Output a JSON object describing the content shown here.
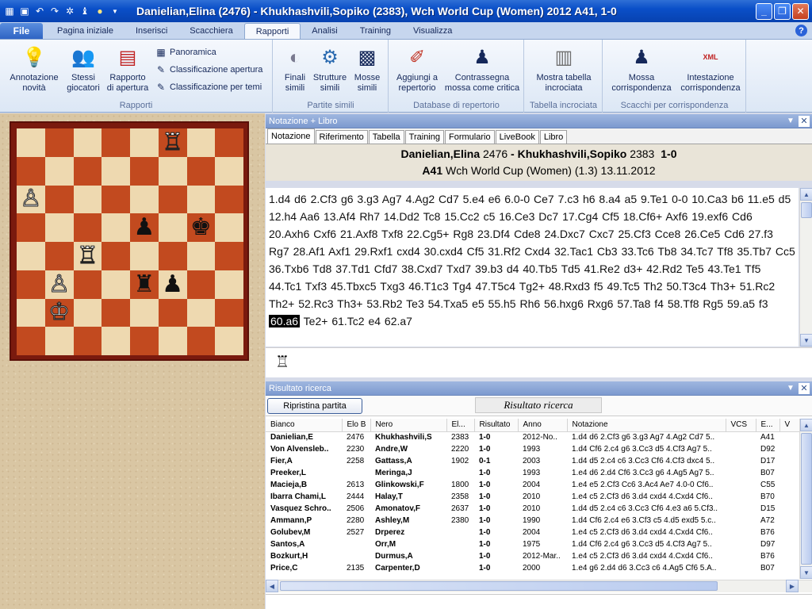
{
  "window": {
    "title": "Danielian,Elina (2476) - Khukhashvili,Sopiko (2383), Wch World Cup (Women) 2012  A41, 1-0",
    "qat_icons": [
      "board-icon",
      "save-icon",
      "undo-icon",
      "redo-icon",
      "engine-icon",
      "piece-icon",
      "bulb-icon",
      "dropdown-icon"
    ],
    "minimize": "_",
    "maximize": "❐",
    "close": "✕"
  },
  "ribbon": {
    "file_tab": "File",
    "tabs": [
      "Pagina iniziale",
      "Inserisci",
      "Scacchiera",
      "Rapporti",
      "Analisi",
      "Training",
      "Visualizza"
    ],
    "active_tab": "Rapporti",
    "help": "?",
    "groups": {
      "rapporti": {
        "label": "Rapporti",
        "annotazione": "Annotazione novità",
        "annotazione_l1": "Annotazione",
        "annotazione_l2": "novità",
        "stessi_l1": "Stessi",
        "stessi_l2": "giocatori",
        "rapporto_l1": "Rapporto",
        "rapporto_l2": "di apertura",
        "panoramica": "Panoramica",
        "class_apertura": "Classificazione apertura",
        "class_temi": "Classificazione per temi"
      },
      "partite_simili": {
        "label": "Partite simili",
        "finali_l1": "Finali",
        "finali_l2": "simili",
        "strutture_l1": "Strutture",
        "strutture_l2": "simili",
        "mosse_l1": "Mosse",
        "mosse_l2": "simili"
      },
      "database": {
        "label": "Database di repertorio",
        "aggiungi_l1": "Aggiungi a",
        "aggiungi_l2": "repertorio",
        "contrassegna_l1": "Contrassegna",
        "contrassegna_l2": "mossa come critica"
      },
      "tabella": {
        "label": "Tabella incrociata",
        "mostra_l1": "Mostra tabella",
        "mostra_l2": "incrociata"
      },
      "corrispondenza": {
        "label": "Scacchi per corrispondenza",
        "mossa_l1": "Mossa",
        "mossa_l2": "corrispondenza",
        "intest_l1": "Intestazione",
        "intest_l2": "corrispondenza",
        "xml_badge": "XML"
      }
    }
  },
  "board": {
    "squares": [
      "",
      "",
      "",
      "",
      "",
      "R",
      "",
      "",
      "",
      "",
      "",
      "",
      "",
      "",
      "",
      "",
      "P",
      "",
      "",
      "",
      "",
      "",
      "",
      "",
      "",
      "",
      "",
      "",
      "p",
      "",
      "k",
      "",
      "",
      "",
      "R",
      "",
      "",
      "",
      "",
      "",
      "",
      "P",
      "",
      "",
      "r",
      "p",
      "",
      "",
      "",
      "K",
      "",
      "",
      "",
      "",
      "",
      "",
      "",
      "",
      "",
      "",
      "",
      "",
      "",
      ""
    ]
  },
  "notation_pane": {
    "title": "Notazione + Libro",
    "tabs": [
      "Notazione",
      "Riferimento",
      "Tabella",
      "Training",
      "Formulario",
      "LiveBook",
      "Libro"
    ],
    "active_tab": "Notazione",
    "white": "Danielian,Elina",
    "white_elo": "2476",
    "sep": "-",
    "black": "Khukhashvili,Sopiko",
    "black_elo": "2383",
    "result": "1-0",
    "eco": "A41",
    "event": "Wch World Cup (Women) (1.3) 13.11.2012",
    "moves_before": "1.d4  d6  2.Cf3  g6  3.g3  Ag7  4.Ag2  Cd7  5.e4  e6  6.0-0  Ce7  7.c3  h6  8.a4  a5  9.Te1  0-0  10.Ca3  b6  11.e5  d5  12.h4  Aa6  13.Af4  Rh7  14.Dd2  Tc8  15.Cc2  c5  16.Ce3  Dc7  17.Cg4  Cf5  18.Cf6+  Axf6  19.exf6  Cd6  20.Axh6  Cxf6  21.Axf8  Txf8  22.Cg5+  Rg8  23.Df4  Cde8  24.Dxc7  Cxc7  25.Cf3  Cce8  26.Ce5  Cd6  27.f3  Rg7  28.Af1  Axf1  29.Rxf1  cxd4  30.cxd4  Cf5  31.Rf2  Cxd4  32.Tac1  Cb3  33.Tc6  Tb8  34.Tc7  Tf8  35.Tb7  Cc5  36.Txb6  Td8  37.Td1  Cfd7  38.Cxd7  Txd7  39.b3  d4  40.Tb5  Td5  41.Re2  d3+  42.Rd2  Te5  43.Te1  Tf5  44.Tc1  Txf3  45.Tbxc5  Txg3  46.T1c3  Tg4  47.T5c4  Tg2+  48.Rxd3  f5  49.Tc5  Th2  50.T3c4  Th3+  51.Rc2  Th2+  52.Rc3  Th3+  53.Rb2  Te3  54.Txa5  e5  55.h5  Rh6  56.hxg6  Rxg6  57.Ta8  f4  58.Tf8  Rg5  59.a5  f3  ",
    "current_move": "60.a6",
    "moves_after": "  Te2+  61.Tc2  e4  62.a7"
  },
  "search_pane": {
    "title": "Risultato ricerca",
    "reset_button": "Ripristina partita",
    "label": "Risultato ricerca",
    "columns": [
      "Bianco",
      "Elo B",
      "Nero",
      "El...",
      "Risultato",
      "Anno",
      "Notazione",
      "VCS",
      "E...",
      "V"
    ],
    "rows": [
      [
        "Danielian,E",
        "2476",
        "Khukhashvili,S",
        "2383",
        "1-0",
        "2012-No..",
        "1.d4 d6 2.Cf3 g6 3.g3 Ag7 4.Ag2 Cd7 5..",
        "",
        "A41"
      ],
      [
        "Von Alvensleb..",
        "2230",
        "Andre,W",
        "2220",
        "1-0",
        "1993",
        "1.d4 Cf6 2.c4 g6 3.Cc3 d5 4.Cf3 Ag7 5..",
        "",
        "D92"
      ],
      [
        "Fier,A",
        "2258",
        "Gattass,A",
        "1902",
        "0-1",
        "2003",
        "1.d4 d5 2.c4 c6 3.Cc3 Cf6 4.Cf3 dxc4 5..",
        "",
        "D17"
      ],
      [
        "Preeker,L",
        "",
        "Meringa,J",
        "",
        "1-0",
        "1993",
        "1.e4 d6 2.d4 Cf6 3.Cc3 g6 4.Ag5 Ag7 5..",
        "",
        "B07"
      ],
      [
        "Macieja,B",
        "2613",
        "Glinkowski,F",
        "1800",
        "1-0",
        "2004",
        "1.e4 e5 2.Cf3 Cc6 3.Ac4 Ae7 4.0-0 Cf6..",
        "",
        "C55"
      ],
      [
        "Ibarra Chami,L",
        "2444",
        "Halay,T",
        "2358",
        "1-0",
        "2010",
        "1.e4 c5 2.Cf3 d6 3.d4 cxd4 4.Cxd4 Cf6..",
        "",
        "B70"
      ],
      [
        "Vasquez Schro..",
        "2506",
        "Amonatov,F",
        "2637",
        "1-0",
        "2010",
        "1.d4 d5 2.c4 c6 3.Cc3 Cf6 4.e3 a6 5.Cf3..",
        "",
        "D15"
      ],
      [
        "Ammann,P",
        "2280",
        "Ashley,M",
        "2380",
        "1-0",
        "1990",
        "1.d4 Cf6 2.c4 e6 3.Cf3 c5 4.d5 exd5 5.c..",
        "",
        "A72"
      ],
      [
        "Golubev,M",
        "2527",
        "Drperez",
        "",
        "1-0",
        "2004",
        "1.e4 c5 2.Cf3 d6 3.d4 cxd4 4.Cxd4 Cf6..",
        "",
        "B76"
      ],
      [
        "Santos,A",
        "",
        "Orr,M",
        "",
        "1-0",
        "1975",
        "1.d4 Cf6 2.c4 g6 3.Cc3 d5 4.Cf3 Ag7 5..",
        "",
        "D97"
      ],
      [
        "Bozkurt,H",
        "",
        "Durmus,A",
        "",
        "1-0",
        "2012-Mar..",
        "1.e4 c5 2.Cf3 d6 3.d4 cxd4 4.Cxd4 Cf6..",
        "",
        "B76"
      ],
      [
        "Price,C",
        "2135",
        "Carpenter,D",
        "",
        "1-0",
        "2000",
        "1.e4 g6 2.d4 d6 3.Cc3 c6 4.Ag5 Cf6 5.A..",
        "",
        "B07"
      ]
    ]
  },
  "colors": {
    "title_blue": "#0a4fc8",
    "board_dark": "#c24a1f",
    "board_light": "#eed9b0",
    "board_frame": "#7a1a0e",
    "pane_header": "#7c99cf"
  }
}
